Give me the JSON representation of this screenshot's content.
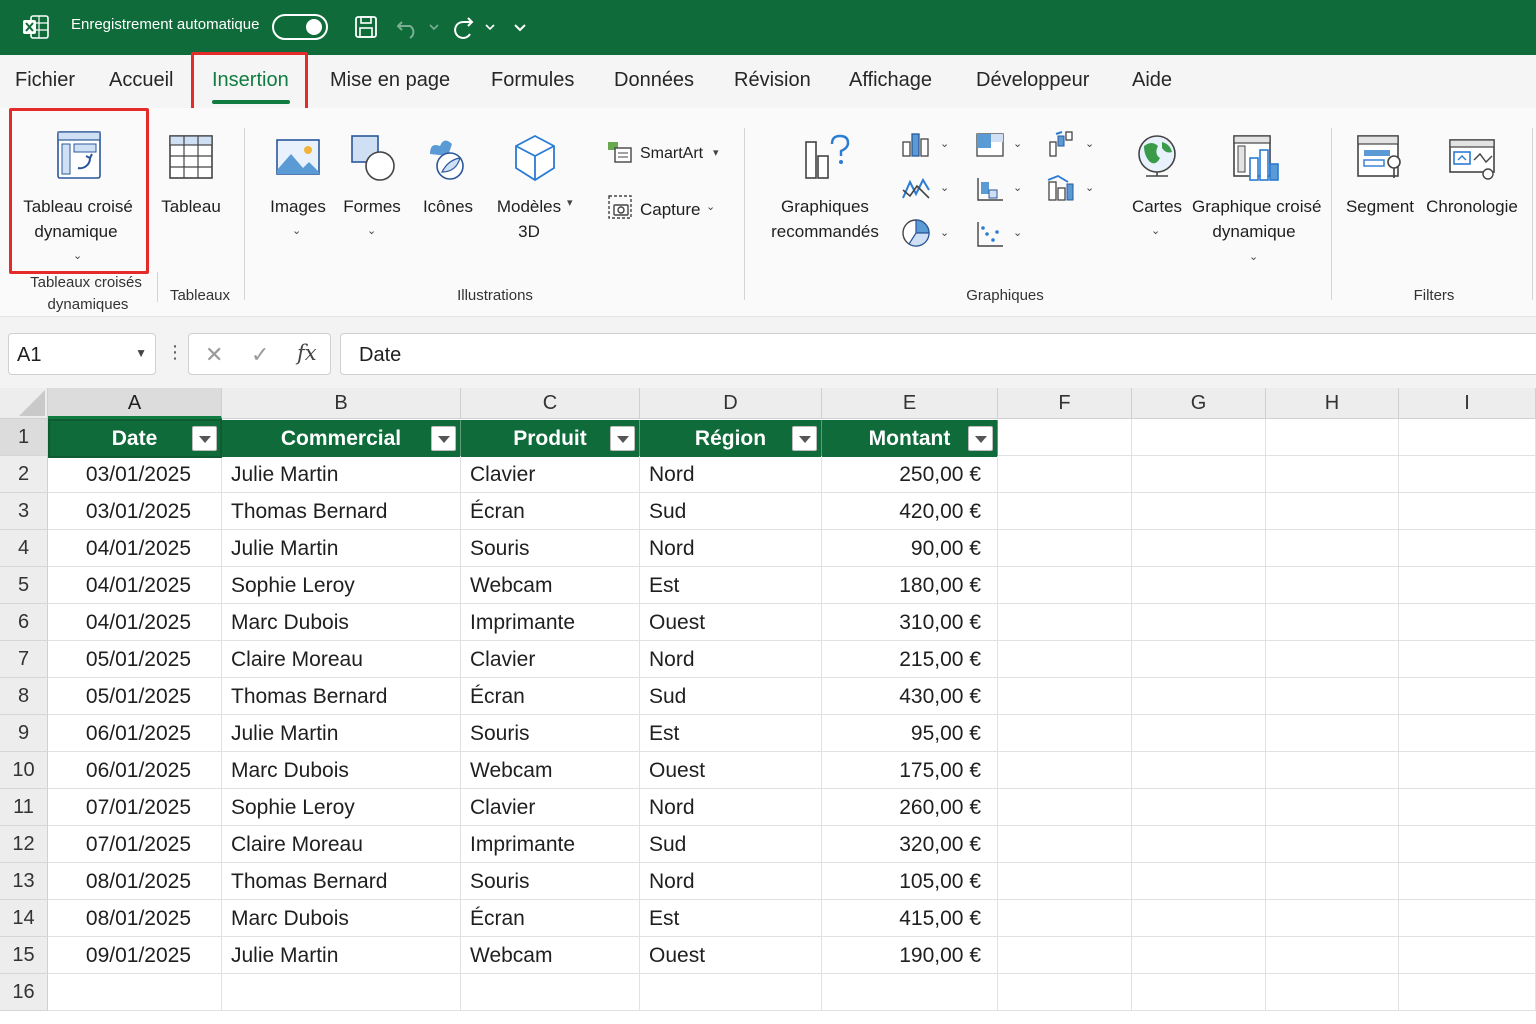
{
  "titlebar": {
    "autosave_label": "Enregistrement automatique",
    "autosave_state": "on",
    "icons": [
      "excel-logo-icon",
      "save-icon",
      "undo-icon",
      "redo-icon",
      "customize-qat-icon"
    ]
  },
  "tabs": [
    "Fichier",
    "Accueil",
    "Insertion",
    "Mise en page",
    "Formules",
    "Données",
    "Révision",
    "Affichage",
    "Développeur",
    "Aide"
  ],
  "active_tab": "Insertion",
  "ribbon": {
    "pivot_table": {
      "line1": "Tableau croisé",
      "line2": "dynamique"
    },
    "table": "Tableau",
    "images": "Images",
    "shapes": "Formes",
    "icons": "Icônes",
    "models3d": {
      "line1": "Modèles",
      "line2": "3D"
    },
    "smartart": "SmartArt",
    "capture": "Capture",
    "recommended_charts": {
      "line1": "Graphiques",
      "line2": "recommandés"
    },
    "maps": "Cartes",
    "pivot_chart": {
      "line1": "Graphique croisé",
      "line2": "dynamique"
    },
    "slicer": "Segment",
    "timeline": "Chronologie",
    "groups": {
      "pivot_tables": {
        "line1": "Tableaux croisés",
        "line2": "dynamiques"
      },
      "tables": "Tableaux",
      "illustrations": "Illustrations",
      "charts": "Graphiques",
      "filters": "Filters"
    }
  },
  "formula_bar": {
    "name_box": "A1",
    "formula": "Date",
    "fx": "fx",
    "more": "⋮",
    "cancel": "✕",
    "enter": "✓"
  },
  "sheet": {
    "columns": [
      "A",
      "B",
      "C",
      "D",
      "E",
      "F",
      "G",
      "H",
      "I"
    ],
    "row_numbers": [
      "1",
      "2",
      "3",
      "4",
      "5",
      "6",
      "7",
      "8",
      "9",
      "10",
      "11",
      "12",
      "13",
      "14",
      "15",
      "16"
    ],
    "table_headers": [
      "Date",
      "Commercial",
      "Produit",
      "Région",
      "Montant"
    ],
    "rows": [
      [
        "03/01/2025",
        "Julie Martin",
        "Clavier",
        "Nord",
        "250,00 €"
      ],
      [
        "03/01/2025",
        "Thomas Bernard",
        "Écran",
        "Sud",
        "420,00 €"
      ],
      [
        "04/01/2025",
        "Julie Martin",
        "Souris",
        "Nord",
        "90,00 €"
      ],
      [
        "04/01/2025",
        "Sophie Leroy",
        "Webcam",
        "Est",
        "180,00 €"
      ],
      [
        "04/01/2025",
        "Marc Dubois",
        "Imprimante",
        "Ouest",
        "310,00 €"
      ],
      [
        "05/01/2025",
        "Claire Moreau",
        "Clavier",
        "Nord",
        "215,00 €"
      ],
      [
        "05/01/2025",
        "Thomas Bernard",
        "Écran",
        "Sud",
        "430,00 €"
      ],
      [
        "06/01/2025",
        "Julie Martin",
        "Souris",
        "Est",
        "95,00 €"
      ],
      [
        "06/01/2025",
        "Marc Dubois",
        "Webcam",
        "Ouest",
        "175,00 €"
      ],
      [
        "07/01/2025",
        "Sophie Leroy",
        "Clavier",
        "Nord",
        "260,00 €"
      ],
      [
        "07/01/2025",
        "Claire Moreau",
        "Imprimante",
        "Sud",
        "320,00 €"
      ],
      [
        "08/01/2025",
        "Thomas Bernard",
        "Souris",
        "Nord",
        "105,00 €"
      ],
      [
        "08/01/2025",
        "Marc Dubois",
        "Écran",
        "Est",
        "415,00 €"
      ],
      [
        "09/01/2025",
        "Julie Martin",
        "Webcam",
        "Ouest",
        "190,00 €"
      ]
    ],
    "selected_cell": "A1"
  },
  "colors": {
    "excel_green": "#0f6b3a",
    "accent_green": "#107c41",
    "highlight_red": "#e52a2a"
  }
}
